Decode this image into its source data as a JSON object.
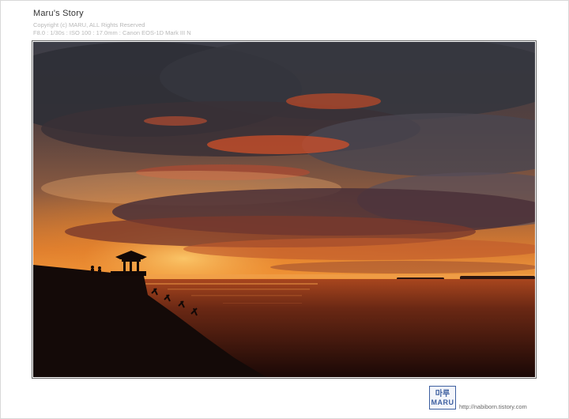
{
  "header": {
    "title": "Maru's Story",
    "copyright": "Copyright (c) MARU, ALL Rights Reserved",
    "exif": "F8.0 : 1/30s : ISO 100 : 17.0mm : Canon EOS-1D Mark III N"
  },
  "photo": {
    "subject": "sunset-over-sea-with-pavilion-silhouette"
  },
  "footer": {
    "logo_top": "마루",
    "logo_bottom": "MARU",
    "url": "http://nabiborn.tistory.com"
  },
  "colors": {
    "sky_top": "#3a3a44",
    "horizon_glow": "#f08a2a",
    "sea": "#3a1a10",
    "logo_accent": "#3d5fa0"
  }
}
